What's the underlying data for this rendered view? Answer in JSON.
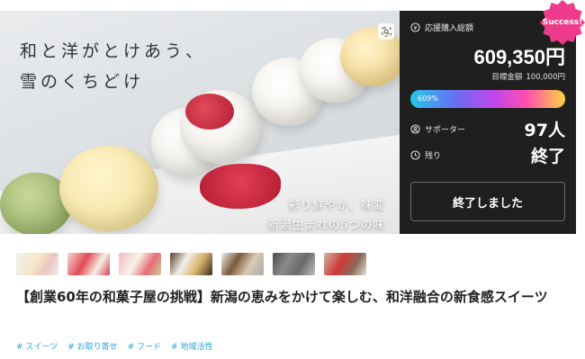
{
  "hero": {
    "title_line1": "和と洋がとけあう、",
    "title_line2": "雪のくちどけ",
    "sub_line1": "彩り鮮やか、味変",
    "sub_line2": "新潟生まれの5つの味"
  },
  "panel": {
    "total_label": "応援購入総額",
    "total_amount": "609,350円",
    "goal_label": "目標金額",
    "goal_amount": "100,000円",
    "progress_text": "609%",
    "progress_percent": 609,
    "supporters_label": "サポーター",
    "supporters_value": "97人",
    "remaining_label": "残り",
    "remaining_value": "終了",
    "ended_button": "終了しました"
  },
  "badge": {
    "success": "Success!"
  },
  "project": {
    "title": "【創業60年の和菓子屋の挑戦】新潟の恵みをかけて楽しむ、和洋融合の新食感スイーツ",
    "tags": [
      "# スイーツ",
      "# お取り寄せ",
      "# フード",
      "# 地域活性"
    ]
  },
  "colors": {
    "panel_bg": "#1f1f1f",
    "badge_pink": "#ee3b8b",
    "tag_blue": "#2aa3d6"
  },
  "icons": {
    "zoom": "zoom-icon",
    "yen": "yen-icon",
    "user": "user-icon",
    "clock": "clock-icon"
  }
}
